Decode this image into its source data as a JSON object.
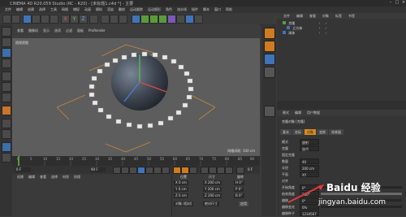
{
  "app": {
    "title": "CINEMA 4D R20.059 Studio (RC - R20) - [未标题1.c4d *] - 主要"
  },
  "menubar": [
    "文件",
    "编辑",
    "创建",
    "选择",
    "工具",
    "网格",
    "捕捉",
    "动画",
    "模拟",
    "渲染",
    "雕刻",
    "运动跟踪",
    "运动图形",
    "角色",
    "流水线",
    "插件",
    "脚本",
    "窗口",
    "帮助"
  ],
  "toolbar": {
    "xyz": [
      "X",
      "Y",
      "Z"
    ]
  },
  "viewport": {
    "menu": [
      "查看",
      "摄像机",
      "显示",
      "选项",
      "过滤",
      "面板",
      "ProRender"
    ],
    "label": "透视视图",
    "grid_text": "网格间距: 100 cm"
  },
  "object_manager": {
    "tabs": [
      "文件",
      "编辑",
      "查看",
      "对象",
      "标签",
      "书签"
    ],
    "items": [
      {
        "name": "克隆"
      },
      {
        "name": "立方体"
      },
      {
        "name": "球体"
      }
    ]
  },
  "attribute_panel": {
    "tabs": [
      "模式",
      "编辑",
      "用户数据"
    ],
    "header": "克隆对象 [克隆]",
    "subtabs": [
      "基本",
      "坐标",
      "对象",
      "变换",
      "效果器"
    ],
    "active_subtab": "对象",
    "properties": [
      {
        "label": "模式",
        "value": "放射"
      },
      {
        "label": "克隆",
        "value": "迭代"
      },
      {
        "label": "固定克隆",
        "value": ""
      },
      {
        "label": "数量",
        "value": "40"
      },
      {
        "label": "半径",
        "value": "200 cm"
      },
      {
        "label": "平面",
        "value": "XY"
      },
      {
        "label": "对齐",
        "value": ""
      },
      {
        "label": "开始角度",
        "value": "0°"
      },
      {
        "label": "结束角度",
        "value": "360°"
      },
      {
        "label": "偏移",
        "value": "0°"
      },
      {
        "label": "偏移变化",
        "value": "0%"
      },
      {
        "label": "偏移种子",
        "value": "1234567"
      }
    ]
  },
  "timeline": {
    "ticks": [
      "0",
      "5",
      "10",
      "15",
      "20",
      "25",
      "30",
      "35",
      "40",
      "45",
      "50",
      "55",
      "60",
      "65",
      "70",
      "75",
      "80",
      "85",
      "90"
    ],
    "frame_start": "0 F",
    "frame_current": "0 F",
    "frame_end": "90 F"
  },
  "bottom_left": {
    "menu": [
      "创建",
      "编辑",
      "查看",
      "选择",
      "材质",
      "纹理"
    ]
  },
  "coordinates": {
    "headers": [
      "位置",
      "尺寸",
      "旋转"
    ],
    "rows": [
      {
        "pos": "X 0 cm",
        "size": "X 200 cm",
        "rot": "H 0°"
      },
      {
        "pos": "Y 0 cm",
        "size": "Y 200 cm",
        "rot": "P 0°"
      },
      {
        "pos": "Z 0 cm",
        "size": "Z 200 cm",
        "rot": "B 0°"
      }
    ],
    "mode": "对象 (相对)",
    "mode2": "绝对尺寸",
    "apply": "应用"
  },
  "watermark": {
    "brand": "Baidu 经验",
    "url": "jingyan.baidu.com"
  }
}
